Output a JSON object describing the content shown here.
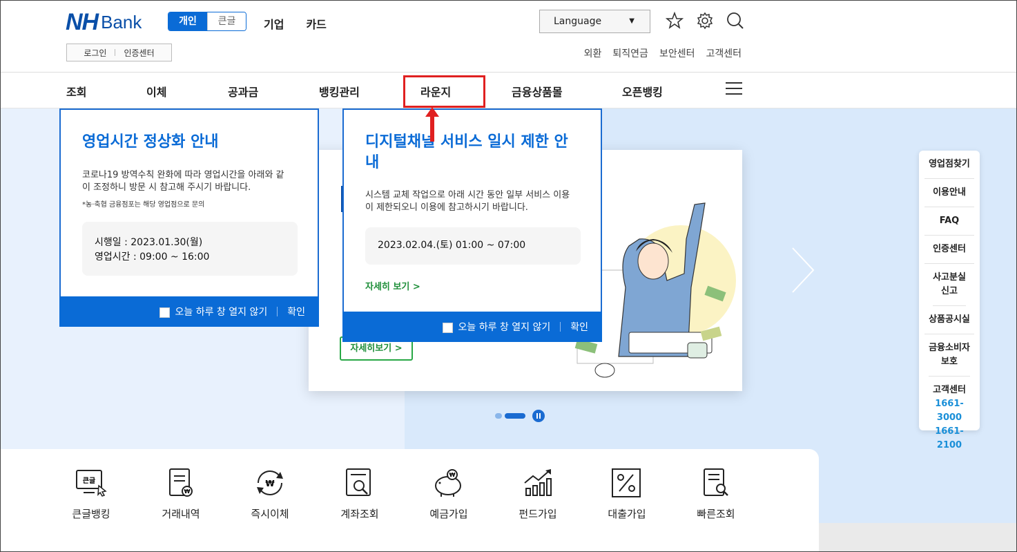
{
  "header": {
    "logo_nh": "NH",
    "logo_bank": "Bank",
    "toggle_personal": "개인",
    "toggle_large": "큰글",
    "top_links": [
      "기업",
      "카드"
    ],
    "login": "로그인",
    "cert": "인증센터",
    "language": "Language",
    "util_links": [
      "외환",
      "퇴직연금",
      "보안센터",
      "고객센터"
    ]
  },
  "gnb": [
    "조회",
    "이체",
    "공과금",
    "뱅킹관리",
    "라운지",
    "금융상품몰",
    "오픈뱅킹"
  ],
  "popup1": {
    "title": "영업시간 정상화 안내",
    "desc": "코로나19 방역수칙 완화에 따라 영업시간을 아래와 같이 조정하니 방문 시 참고해 주시기 바랍니다.",
    "note": "*농·축협 금융점포는 해당 영업점으로 문의",
    "info1": "시행일 : 2023.01.30(월)",
    "info2": "영업시간 : 09:00 ~ 16:00",
    "dont_show": "오늘 하루 창 열지 않기",
    "confirm": "확인"
  },
  "popup2": {
    "title": "디지털채널 서비스 일시 제한 안내",
    "desc": "시스템 교체 작업으로 아래 시간 동안 일부 서비스 이용이 제한되오니 이용에 참고하시기 바랍니다.",
    "info": "2023.02.04.(토) 01:00 ~ 07:00",
    "more": "자세히 보기  >",
    "dont_show": "오늘 하루 창 열지 않기",
    "confirm": "확인"
  },
  "slide": {
    "more_btn": "자세히보기  >"
  },
  "quick": {
    "items": [
      "영업점찾기",
      "이용안내",
      "FAQ",
      "인증센터",
      "사고분실 신고",
      "상품공시실",
      "금융소비자 보호"
    ],
    "cs_label": "고객센터",
    "tel1": "1661-3000",
    "tel2": "1661-2100"
  },
  "quick_menu": [
    "큰글뱅킹",
    "거래내역",
    "즉시이체",
    "계좌조회",
    "예금가입",
    "펀드가입",
    "대출가입",
    "빠른조회"
  ],
  "icons": {
    "star": "star-icon",
    "settings": "gear-icon",
    "search": "search-icon",
    "menu": "hamburger-menu-icon"
  },
  "colors": {
    "brand": "#0a6bd6",
    "highlight": "#e02020",
    "green": "#28a745"
  }
}
